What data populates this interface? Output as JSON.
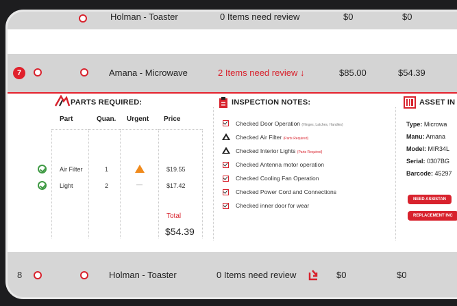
{
  "top_row": {
    "product": "Holman - Toaster",
    "review": "0 Items need review",
    "price": "$0",
    "cost": "$0"
  },
  "row7": {
    "index": "7",
    "product": "Amana - Microwave",
    "review": "2 Items need review",
    "review_arrow": "↓",
    "price": "$85.00",
    "cost": "$54.39"
  },
  "parts": {
    "title": "PARTS REQUIRED:",
    "headers": [
      "Part",
      "Quan.",
      "Urgent",
      "Price"
    ],
    "rows": [
      {
        "part": "Air Filter",
        "qty": "1",
        "urgent": "warning",
        "price": "$19.55"
      },
      {
        "part": "Light",
        "qty": "2",
        "urgent": "—",
        "price": "$17.42"
      }
    ],
    "total_label": "Total",
    "total_value": "$54.39"
  },
  "inspection": {
    "title": "INSPECTION NOTES:",
    "notes": [
      {
        "icon": "checkbox-icon",
        "text": "Checked Door Operation",
        "detail": "(Hinges, Latches, Handles)"
      },
      {
        "icon": "warning-triangle-icon",
        "text": "Checked Air Filter",
        "req": "(Parts Required)"
      },
      {
        "icon": "warning-triangle-icon",
        "text": "Checked Interior Lights",
        "req": "(Parts Required)"
      },
      {
        "icon": "checkbox-icon",
        "text": "Checked Antenna motor operation"
      },
      {
        "icon": "checkbox-icon",
        "text": "Checked Cooling Fan Operation"
      },
      {
        "icon": "checkbox-icon",
        "text": "Checked Power Cord and Connections"
      },
      {
        "icon": "checkbox-icon",
        "text": "Checked inner door for wear"
      }
    ]
  },
  "asset": {
    "title": "ASSET IN",
    "type_label": "Type:",
    "type_value": "Microwa",
    "manu_label": "Manu:",
    "manu_value": "Amana",
    "model_label": "Model:",
    "model_value": "MIR34L",
    "serial_label": "Serial:",
    "serial_value": "0307BG",
    "barcode_label": "Barcode:",
    "barcode_value": "45297",
    "btn1": "NEED ASSISTAN",
    "btn2": "REPLACEMENT INC"
  },
  "row8": {
    "index": "8",
    "product": "Holman - Toaster",
    "review": "0 Items need review",
    "price": "$0",
    "cost": "$0"
  },
  "colors": {
    "accent": "#d8222d",
    "row_bg": "#d6d6d6",
    "ok": "#3f9a44",
    "warn": "#f08a1c"
  }
}
